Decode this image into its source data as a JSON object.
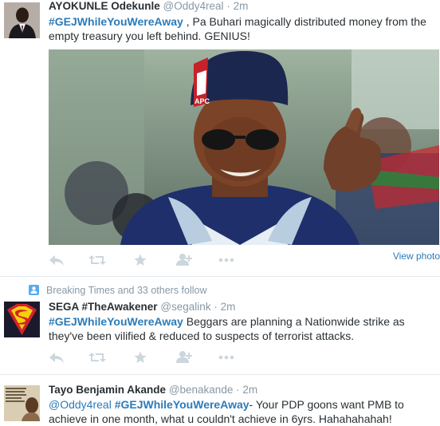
{
  "tweets": [
    {
      "name": "AYOKUNLE Odekunle",
      "handle": "@Oddy4real",
      "dot": "·",
      "time": "2m",
      "hashtag": "#GEJWhileYouWereAway",
      "text": " , Pa Buhari magically distributed money from the empty treasury you left behind. GENIUS!",
      "photo_cap_text": "APC",
      "view_photo": "View photo"
    },
    {
      "context": "Breaking Times and 33 others follow",
      "name": "SEGA #TheAwakener",
      "handle": "@segalink",
      "dot": "·",
      "time": "2m",
      "hashtag": "#GEJWhileYouWereAway",
      "text": " Beggars are planning a Nationwide strike as they've been vilified & reduced to suspects of terrorist attacks."
    },
    {
      "name": "Tayo Benjamin Akande",
      "handle": "@benakande",
      "dot": "·",
      "time": "2m",
      "mention": "@Oddy4real",
      "hashtag": "#GEJWhileYouWereAway",
      "text": "- Your PDP goons want PMB to achieve in one month, what u couldn't achieve in 6yrs. Hahahahahah!"
    }
  ],
  "actions": [
    "reply-icon",
    "retweet-icon",
    "favorite-icon",
    "follow-icon",
    "more-icon"
  ],
  "colors": {
    "link": "#2b7bb9",
    "muted": "#8899a6",
    "icon": "#ccd6dd",
    "divider": "#e1e8ed"
  }
}
